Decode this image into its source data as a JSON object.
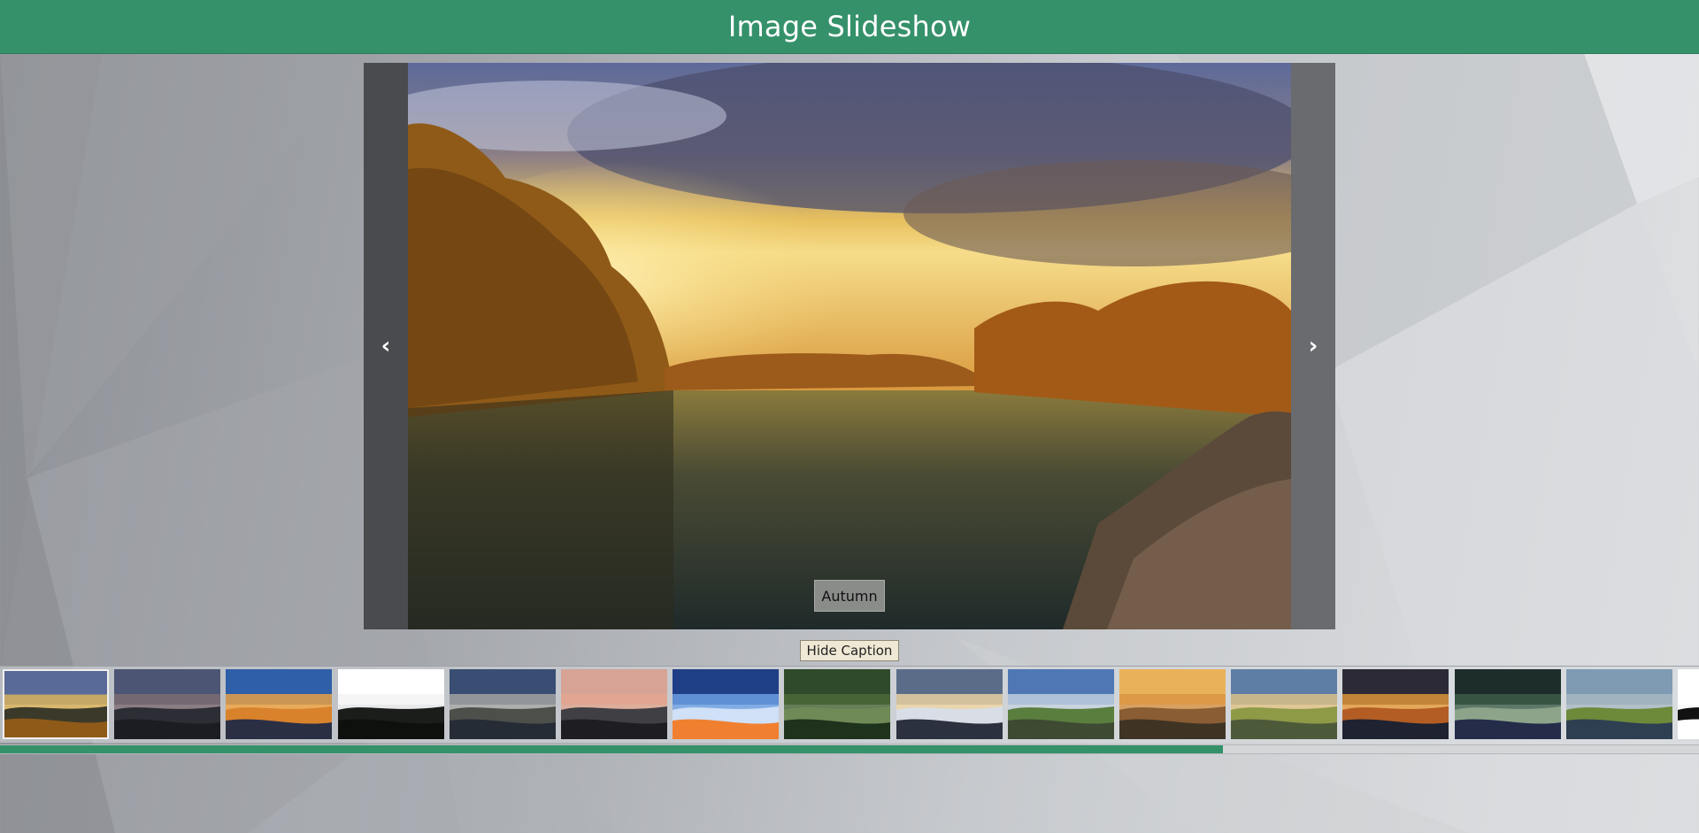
{
  "app": {
    "title": "Image Slideshow"
  },
  "slideshow": {
    "prev_label": "‹",
    "next_label": "›",
    "current_caption": "Autumn",
    "caption_toggle_label": "Hide Caption",
    "progress": 0.72,
    "accent_color": "#35916a"
  },
  "thumbnails": [
    {
      "name": "thumb-autumn-river",
      "selected": true
    },
    {
      "name": "thumb-tree-silhouette-lake"
    },
    {
      "name": "thumb-blue-orange-sunset"
    },
    {
      "name": "thumb-white-sky-trees"
    },
    {
      "name": "thumb-mountain-dusk"
    },
    {
      "name": "thumb-pink-horizon"
    },
    {
      "name": "thumb-streaked-clouds"
    },
    {
      "name": "thumb-green-forest"
    },
    {
      "name": "thumb-cloud-mountains"
    },
    {
      "name": "thumb-lone-tree-hill"
    },
    {
      "name": "thumb-misty-orange-forest"
    },
    {
      "name": "thumb-coastal-cliff"
    },
    {
      "name": "thumb-sunset-lake"
    },
    {
      "name": "thumb-forest-road"
    },
    {
      "name": "thumb-sea-cliff"
    },
    {
      "name": "thumb-partial-white"
    }
  ],
  "icons": {
    "prev": "chevron-left-icon",
    "next": "chevron-right-icon"
  }
}
